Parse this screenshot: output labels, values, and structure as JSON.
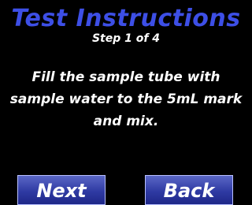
{
  "screen": {
    "title": "Test Instructions",
    "step": "Step 1 of 4",
    "instruction": "Fill the sample tube with sample water to the 5mL mark and mix."
  },
  "buttons": {
    "next_label": "Next",
    "back_label": "Back"
  },
  "colors": {
    "background": "#000000",
    "title": "#3d4fe6",
    "text": "#ffffff",
    "button": "#2f3aa3"
  }
}
